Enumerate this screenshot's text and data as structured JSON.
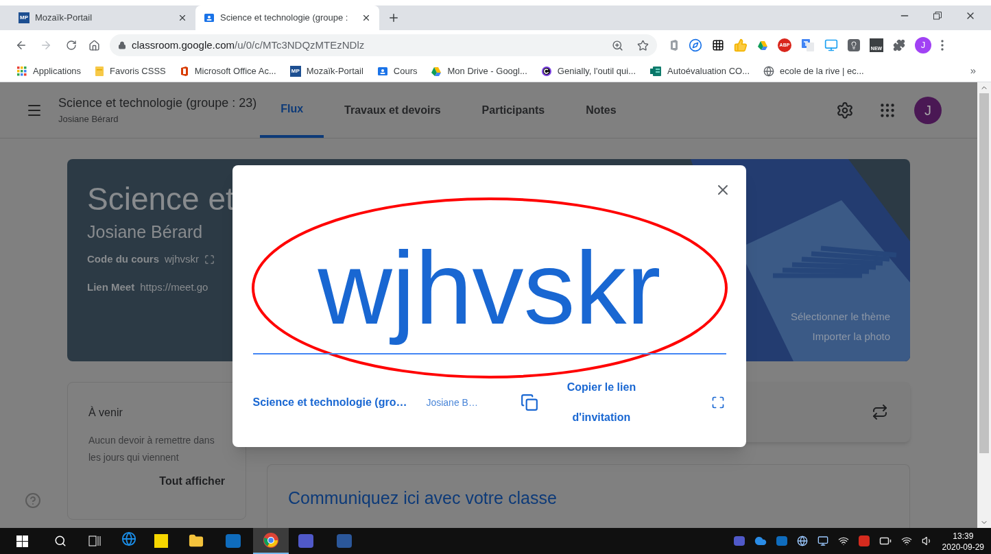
{
  "browser": {
    "tabs": [
      {
        "title": "Mozaïk-Portail",
        "kind": "mp",
        "icon_text": "MP",
        "selected": false
      },
      {
        "title": "Science et technologie (groupe :",
        "kind": "classroom",
        "selected": true
      }
    ],
    "url_host": "classroom.google.com",
    "url_path": "/u/0/c/MTc3NDQzMTEzNDlz",
    "extensions": [
      {
        "kind": "office"
      },
      {
        "kind": "compass"
      },
      {
        "kind": "grid"
      },
      {
        "kind": "thumb"
      },
      {
        "kind": "drive"
      },
      {
        "kind": "abp",
        "label": "ABP"
      },
      {
        "kind": "translate"
      },
      {
        "kind": "screen"
      },
      {
        "kind": "bulb"
      },
      {
        "kind": "news",
        "label": "NEW"
      },
      {
        "kind": "puzzle"
      }
    ],
    "profile": "J",
    "bookmarks": [
      {
        "kind": "apps",
        "label": "Applications"
      },
      {
        "kind": "folder",
        "label": "Favoris CSSS"
      },
      {
        "kind": "office",
        "label": "Microsoft Office Ac..."
      },
      {
        "kind": "mp",
        "icon_text": "MP",
        "label": "Mozaïk-Portail"
      },
      {
        "kind": "classroom",
        "label": "Cours"
      },
      {
        "kind": "drive",
        "label": "Mon Drive - Googl..."
      },
      {
        "kind": "genially",
        "label": "Genially, l'outil qui..."
      },
      {
        "kind": "forms",
        "label": "Autoévaluation CO..."
      },
      {
        "kind": "globe",
        "label": "ecole de la rive | ec..."
      }
    ],
    "bookmarks_more": "»"
  },
  "classroom": {
    "title": "Science et technologie (groupe : 23)",
    "teacher": "Josiane Bérard",
    "tabs": [
      {
        "label": "Flux",
        "selected": true
      },
      {
        "label": "Travaux et devoirs",
        "selected": false
      },
      {
        "label": "Participants",
        "selected": false
      },
      {
        "label": "Notes",
        "selected": false
      }
    ],
    "avatar": "J",
    "banner": {
      "title": "Science et",
      "teacher": "Josiane Bérard",
      "code_label": "Code du cours",
      "code": "wjhvskr",
      "meet_label": "Lien Meet",
      "meet": "https://meet.go",
      "links": [
        "Sélectionner le thème",
        "Importer la photo"
      ]
    },
    "upcoming": {
      "title": "À venir",
      "text": "Aucun devoir à remettre dans les jours qui viennent",
      "link": "Tout afficher"
    },
    "stream_prompt": "Communiquez ici avec votre classe"
  },
  "dialog": {
    "code": "wjhvskr",
    "class_name": "Science et technologie (gro…",
    "teacher": "Josiane B…",
    "copy_link": "Copier le lien d'invitation"
  },
  "taskbar": {
    "time": "13:39",
    "date": "2020-09-29"
  }
}
